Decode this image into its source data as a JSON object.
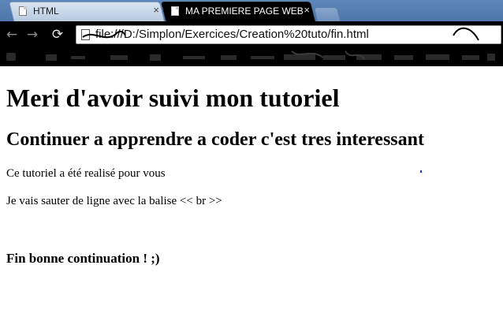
{
  "browser": {
    "tabs": [
      {
        "title": "HTML",
        "close": "×",
        "active": false
      },
      {
        "title": "MA PREMIERE PAGE WEB",
        "close": "×",
        "active": true
      }
    ],
    "nav": {
      "back": "←",
      "forward": "→",
      "reload": "⟳"
    },
    "address_bar": {
      "url": "file:///D:/Simplon/Exercices/Creation%20tuto/fin.html"
    }
  },
  "page": {
    "heading1": "Meri d'avoir suivi mon tutoriel",
    "heading2": "Continuer a apprendre a coder c'est tres interessant",
    "paragraph1": "Ce tutoriel a été realisé pour vous",
    "paragraph2": "Je vais sauter de ligne avec la balise << br >>",
    "closing": "Fin bonne continuation ! ;)"
  },
  "colors": {
    "tabstrip": "#5a82b6",
    "active_tab": "#000000",
    "toolbar": "#000000",
    "page_background": "#ffffff"
  }
}
